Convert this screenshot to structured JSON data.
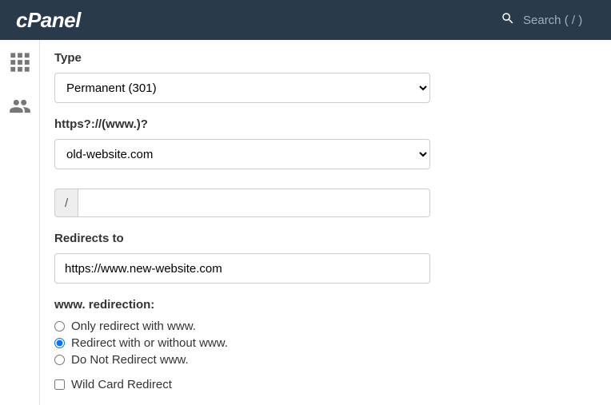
{
  "header": {
    "brand": "cPanel",
    "search_placeholder": "Search ( / )"
  },
  "form": {
    "type_label": "Type",
    "type_value": "Permanent (301)",
    "domain_label": "https?://(www.)?",
    "domain_value": "old-website.com",
    "path_prefix": "/",
    "path_value": "",
    "redirects_to_label": "Redirects to",
    "redirects_to_value": "https://www.new-website.com",
    "www_label": "www. redirection:",
    "www_options": {
      "only": "Only redirect with www.",
      "both": "Redirect with or without www.",
      "none": "Do Not Redirect www."
    },
    "wildcard_label": "Wild Card Redirect"
  }
}
